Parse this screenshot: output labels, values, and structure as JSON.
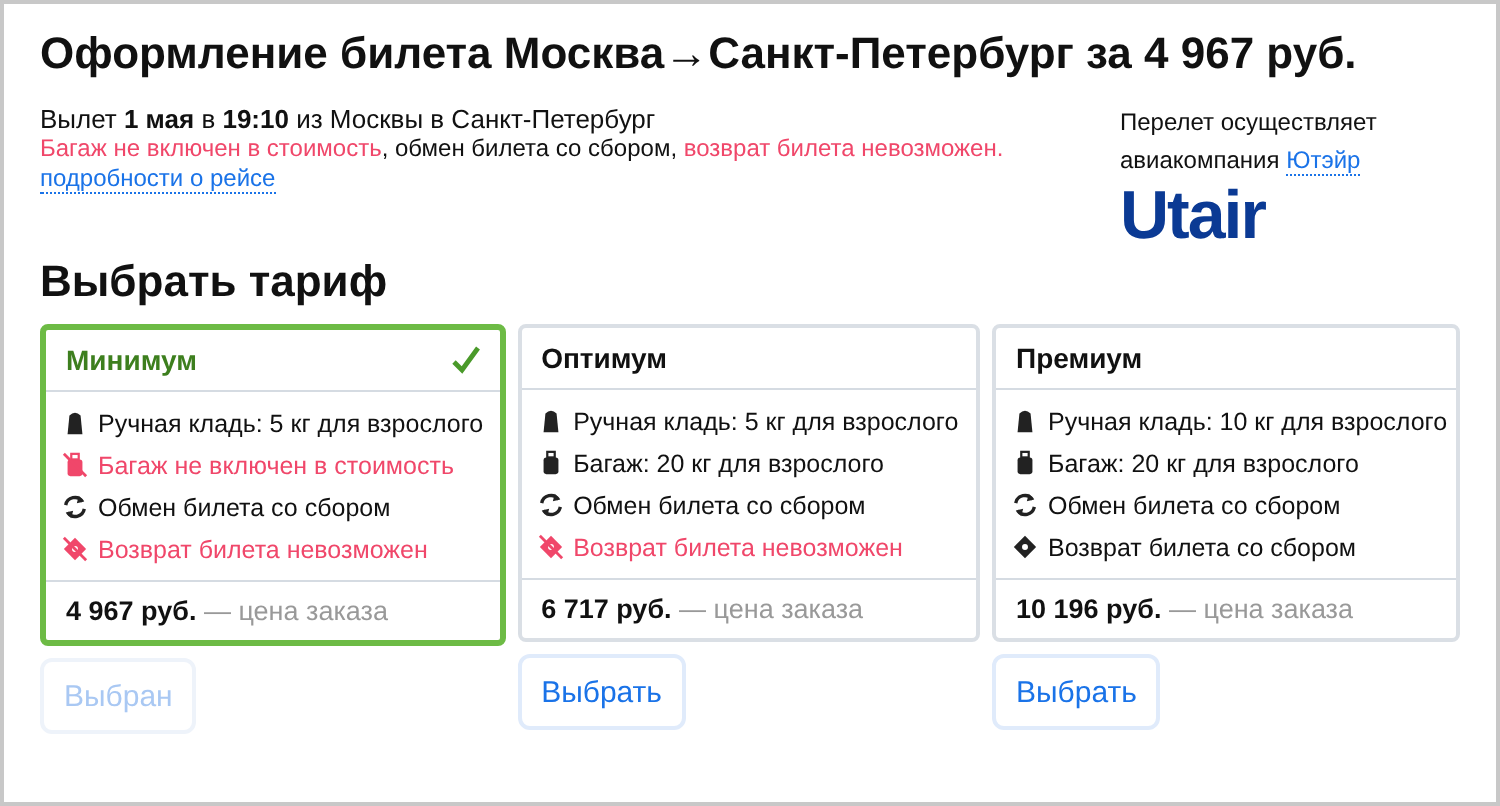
{
  "title": "Оформление билета Москва→Санкт-Петербург за 4 967 руб.",
  "flight": {
    "departure": "Вылет **1 мая** в **19:10** из Москвы в Санкт-Петербург",
    "conditions": [
      {
        "text": "Багаж не включен в стоимость",
        "warning": true
      },
      {
        "text": ", обмен билета со сбором, ",
        "warning": false
      },
      {
        "text": "возврат билета невозможен.",
        "warning": true
      }
    ],
    "details_link": "подробности о рейсе"
  },
  "carrier": {
    "line1": "Перелет осуществляет",
    "line2": "авиакомпания",
    "link": "Ютэйр",
    "logo": "Utair"
  },
  "section_title": "Выбрать тариф",
  "tariffs": [
    {
      "name": "Минимум",
      "selected": true,
      "features": [
        {
          "kind": "handbag",
          "text": "Ручная кладь: 5 кг для взрослого",
          "warning": false
        },
        {
          "kind": "no-baggage",
          "text": "Багаж не включен в стоимость",
          "warning": true
        },
        {
          "kind": "exchange",
          "text": "Обмен билета со сбором",
          "warning": false
        },
        {
          "kind": "no-refund",
          "text": "Возврат билета невозможен",
          "warning": true
        }
      ],
      "price": "4 967 руб.",
      "price_note": "— цена заказа",
      "button": "Выбран"
    },
    {
      "name": "Оптимум",
      "selected": false,
      "features": [
        {
          "kind": "handbag",
          "text": "Ручная кладь: 5 кг для взрослого",
          "warning": false
        },
        {
          "kind": "baggage",
          "text": "Багаж: 20 кг для взрослого",
          "warning": false
        },
        {
          "kind": "exchange",
          "text": "Обмен билета со сбором",
          "warning": false
        },
        {
          "kind": "no-refund",
          "text": "Возврат билета невозможен",
          "warning": true
        }
      ],
      "price": "6 717 руб.",
      "price_note": "— цена заказа",
      "button": "Выбрать"
    },
    {
      "name": "Премиум",
      "selected": false,
      "features": [
        {
          "kind": "handbag",
          "text": "Ручная кладь: 10 кг для взрослого",
          "warning": false
        },
        {
          "kind": "baggage",
          "text": "Багаж: 20 кг для взрослого",
          "warning": false
        },
        {
          "kind": "exchange",
          "text": "Обмен билета со сбором",
          "warning": false
        },
        {
          "kind": "refund",
          "text": "Возврат билета со сбором",
          "warning": false
        }
      ],
      "price": "10 196 руб.",
      "price_note": "— цена заказа",
      "button": "Выбрать"
    }
  ]
}
